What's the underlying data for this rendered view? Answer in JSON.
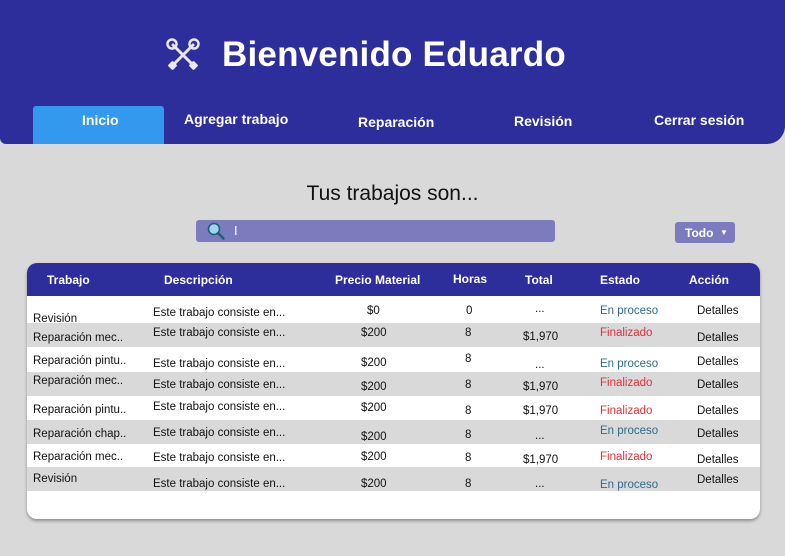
{
  "header": {
    "title": "Bienvenido Eduardo",
    "icon": "crossed-tools-icon",
    "nav": [
      "Inicio",
      "Agregar trabajo",
      "Reparación",
      "Revisión",
      "Cerrar sesión"
    ],
    "active_color": "#3399ee",
    "bg_color": "#2d2d9c"
  },
  "main": {
    "heading": "Tus trabajos son...",
    "search": {
      "value": "I",
      "icon": "search-icon"
    },
    "filter": {
      "label": "Todo",
      "icon": "chevron-down-icon"
    }
  },
  "table": {
    "columns": [
      "Trabajo",
      "Descripción",
      "Precio Material",
      "Horas",
      "Total",
      "Estado",
      "Acción"
    ],
    "rows": [
      [
        "Revisión",
        "Este trabajo consiste en...",
        "$0",
        "0",
        "...",
        "En proceso",
        "Detalles"
      ],
      [
        "Reparación mec..",
        "Este trabajo consiste en...",
        "$200",
        "8",
        "$1,970",
        "Finalizado",
        "Detalles"
      ],
      [
        "Reparación pintu..",
        "Este trabajo consiste en...",
        "$200",
        "8",
        "...",
        "En proceso",
        "Detalles"
      ],
      [
        "Reparación mec..",
        "Este trabajo consiste en...",
        "$200",
        "8",
        "$1,970",
        "Finalizado",
        "Detalles"
      ],
      [
        "Reparación pintu..",
        "Este trabajo consiste en...",
        "$200",
        "8",
        "$1,970",
        "Finalizado",
        "Detalles"
      ],
      [
        "Reparación chap..",
        "Este trabajo consiste en...",
        "$200",
        "8",
        "...",
        "En proceso",
        "Detalles"
      ],
      [
        "Reparación mec..",
        "Este trabajo consiste en...",
        "$200",
        "8",
        "$1,970",
        "Finalizado",
        "Detalles"
      ],
      [
        "Revisión",
        "Este trabajo consiste en...",
        "$200",
        "8",
        "...",
        "En proceso",
        "Detalles"
      ]
    ],
    "status_colors": {
      "En proceso": "#2f6b8c",
      "Finalizado": "#e0303a"
    }
  }
}
